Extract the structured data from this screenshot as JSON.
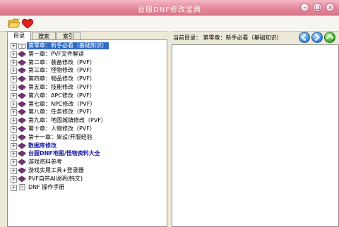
{
  "window": {
    "title": "台服DNF修改宝典"
  },
  "title_buttons": {
    "minimize": "–",
    "restore": "□",
    "close": "×"
  },
  "tabs": [
    {
      "label": "目录"
    },
    {
      "label": "搜索"
    },
    {
      "label": "索引"
    }
  ],
  "tree": [
    {
      "label": "第零章：新手必看（基础知识）",
      "selected": true
    },
    {
      "label": "第一章：PVF文件解读"
    },
    {
      "label": "第二章：装备修改（PVF）"
    },
    {
      "label": "第三章：怪物修改（PVF）"
    },
    {
      "label": "第四章：物品修改（PVF）"
    },
    {
      "label": "第五章：技能修改（PVF）"
    },
    {
      "label": "第六章：APC修改（PVF）"
    },
    {
      "label": "第七章：NPC修改（PVF）"
    },
    {
      "label": "第八章：任务修改（PVF）"
    },
    {
      "label": "第九章：地图城镇修改（PVF）"
    },
    {
      "label": "第十章：人物修改（PVF）"
    },
    {
      "label": "第十一章：架设/开服经验"
    },
    {
      "label": "数据库修改",
      "bold": true
    },
    {
      "label": "台服DNF地图/怪物资料大全",
      "bold": true
    },
    {
      "label": "游戏资料参考"
    },
    {
      "label": "游戏实用工具+登录器"
    },
    {
      "label": "PVF自带AI说明(韩文)"
    },
    {
      "label": "DNF 操作手册",
      "doc": true
    }
  ],
  "right": {
    "path": "当前目录： 第零章：新手必看（基础知识）"
  },
  "colors": {
    "title": "#e48a9c",
    "book": "#7a2f7a",
    "selection": "#316ac5",
    "link_bold": "#1a1aa8"
  }
}
